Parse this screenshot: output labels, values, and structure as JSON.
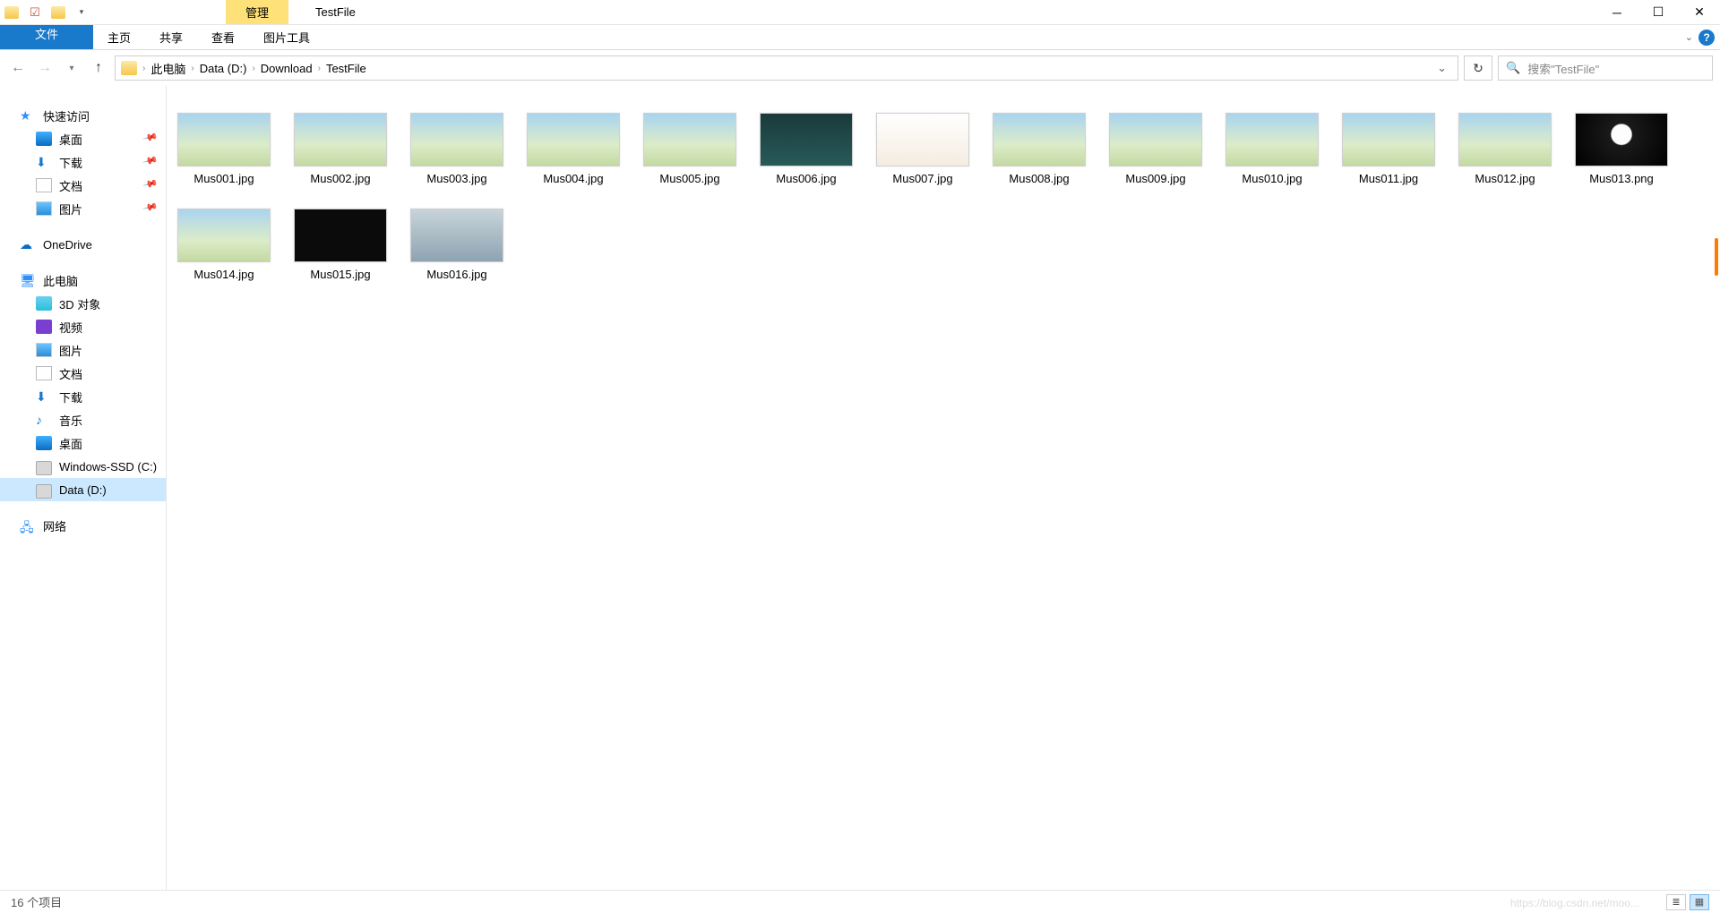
{
  "title": "TestFile",
  "context_tab": "管理",
  "ribbon": {
    "file": "文件",
    "tabs": [
      "主页",
      "共享",
      "查看"
    ],
    "context": "图片工具"
  },
  "breadcrumb": [
    "此电脑",
    "Data (D:)",
    "Download",
    "TestFile"
  ],
  "search_placeholder": "搜索\"TestFile\"",
  "sidebar": {
    "quick_access": {
      "label": "快速访问",
      "items": [
        {
          "label": "桌面",
          "pinned": true,
          "ico": "desktop"
        },
        {
          "label": "下载",
          "pinned": true,
          "ico": "dl"
        },
        {
          "label": "文档",
          "pinned": true,
          "ico": "doc"
        },
        {
          "label": "图片",
          "pinned": true,
          "ico": "img"
        }
      ]
    },
    "onedrive": "OneDrive",
    "this_pc": {
      "label": "此电脑",
      "items": [
        {
          "label": "3D 对象",
          "ico": "3d"
        },
        {
          "label": "视频",
          "ico": "vid"
        },
        {
          "label": "图片",
          "ico": "img"
        },
        {
          "label": "文档",
          "ico": "doc"
        },
        {
          "label": "下载",
          "ico": "dl"
        },
        {
          "label": "音乐",
          "ico": "music"
        },
        {
          "label": "桌面",
          "ico": "desktop"
        },
        {
          "label": "Windows-SSD (C:)",
          "ico": "disk"
        },
        {
          "label": "Data (D:)",
          "ico": "disk",
          "selected": true
        }
      ]
    },
    "network": "网络"
  },
  "files": [
    {
      "name": "Mus001.jpg",
      "style": ""
    },
    {
      "name": "Mus002.jpg",
      "style": ""
    },
    {
      "name": "Mus003.jpg",
      "style": ""
    },
    {
      "name": "Mus004.jpg",
      "style": ""
    },
    {
      "name": "Mus005.jpg",
      "style": ""
    },
    {
      "name": "Mus006.jpg",
      "style": "map"
    },
    {
      "name": "Mus007.jpg",
      "style": "lite"
    },
    {
      "name": "Mus008.jpg",
      "style": ""
    },
    {
      "name": "Mus009.jpg",
      "style": ""
    },
    {
      "name": "Mus010.jpg",
      "style": ""
    },
    {
      "name": "Mus011.jpg",
      "style": ""
    },
    {
      "name": "Mus012.jpg",
      "style": ""
    },
    {
      "name": "Mus013.png",
      "style": "duskmoon"
    },
    {
      "name": "Mus014.jpg",
      "style": ""
    },
    {
      "name": "Mus015.jpg",
      "style": "dark"
    },
    {
      "name": "Mus016.jpg",
      "style": "grey"
    }
  ],
  "status": "16 个项目",
  "watermark": "https://blog.csdn.net/moo..."
}
